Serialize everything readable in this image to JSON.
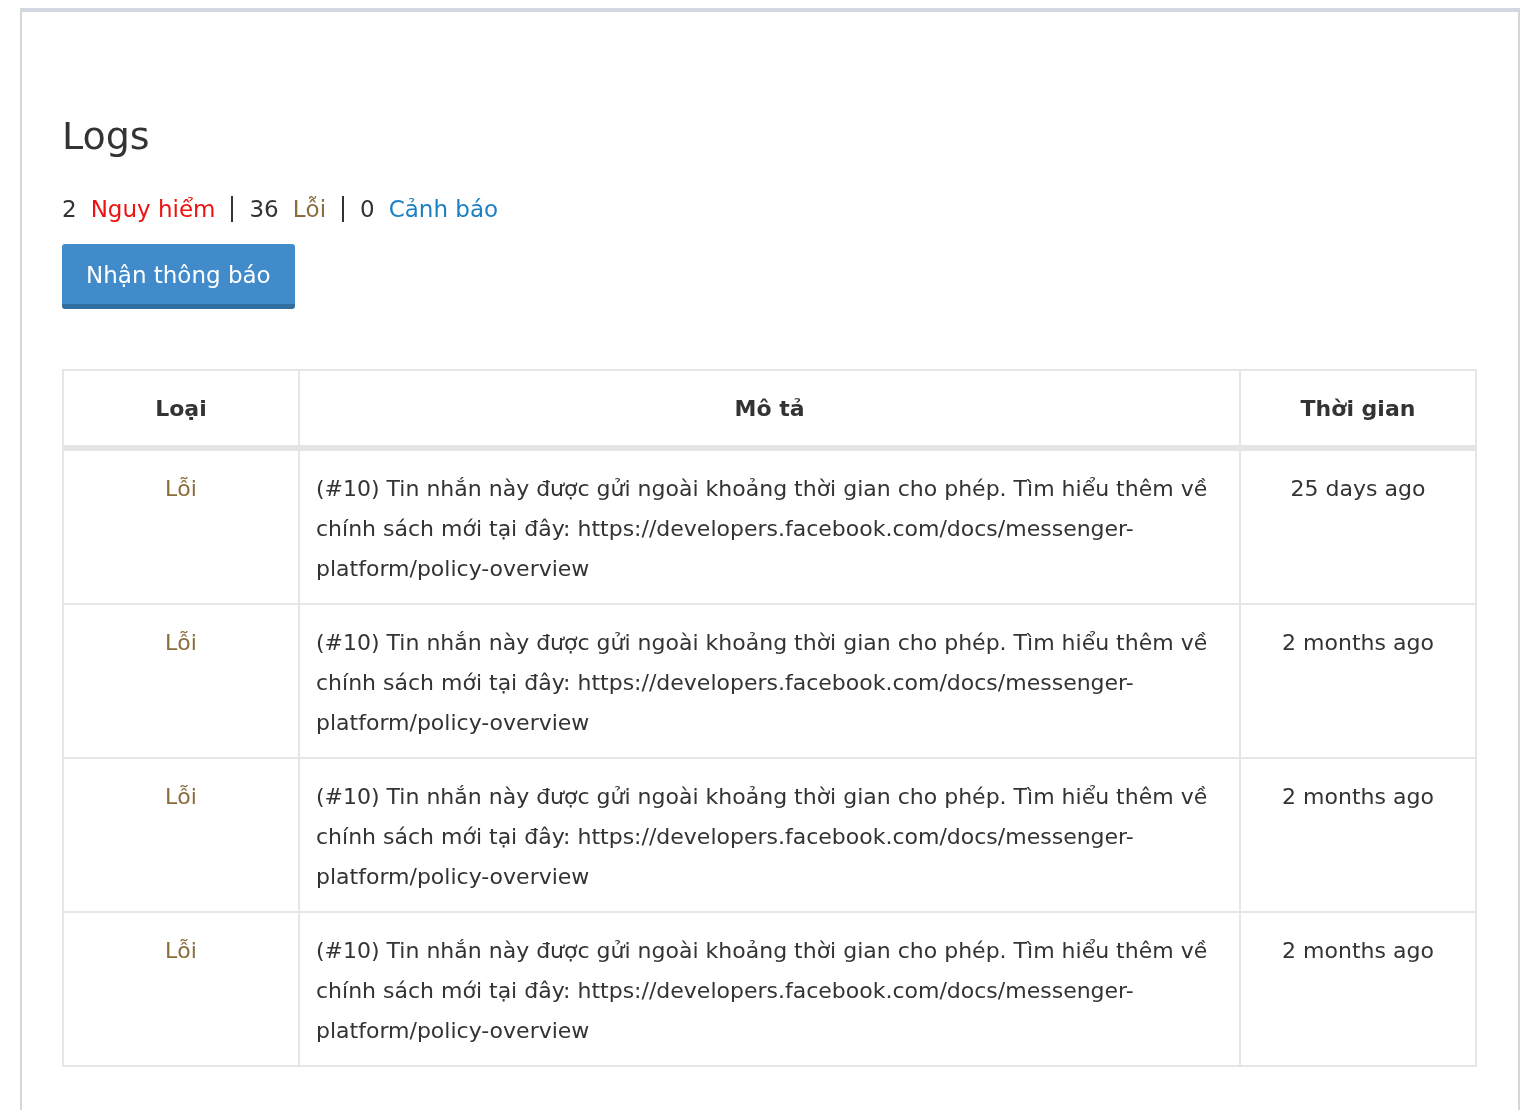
{
  "title": "Logs",
  "summary": [
    {
      "count": "2",
      "label": "Nguy hiểm",
      "kind": "danger"
    },
    {
      "count": "36",
      "label": "Lỗi",
      "kind": "error"
    },
    {
      "count": "0",
      "label": "Cảnh báo",
      "kind": "warning"
    }
  ],
  "subscribe_button": "Nhận thông báo",
  "table": {
    "columns": [
      "Loại",
      "Mô tả",
      "Thời gian"
    ],
    "rows": [
      {
        "type": "Lỗi",
        "kind": "error",
        "description": "(#10) Tin nhắn này được gửi ngoài khoảng thời gian cho phép. Tìm hiểu thêm về chính sách mới tại đây: https://developers.facebook.com/docs/messenger-platform/policy-overview",
        "time": "25 days ago"
      },
      {
        "type": "Lỗi",
        "kind": "error",
        "description": "(#10) Tin nhắn này được gửi ngoài khoảng thời gian cho phép. Tìm hiểu thêm về chính sách mới tại đây: https://developers.facebook.com/docs/messenger-platform/policy-overview",
        "time": "2 months ago"
      },
      {
        "type": "Lỗi",
        "kind": "error",
        "description": "(#10) Tin nhắn này được gửi ngoài khoảng thời gian cho phép. Tìm hiểu thêm về chính sách mới tại đây: https://developers.facebook.com/docs/messenger-platform/policy-overview",
        "time": "2 months ago"
      },
      {
        "type": "Lỗi",
        "kind": "error",
        "description": "(#10) Tin nhắn này được gửi ngoài khoảng thời gian cho phép. Tìm hiểu thêm về chính sách mới tại đây: https://developers.facebook.com/docs/messenger-platform/policy-overview",
        "time": "2 months ago"
      }
    ]
  }
}
